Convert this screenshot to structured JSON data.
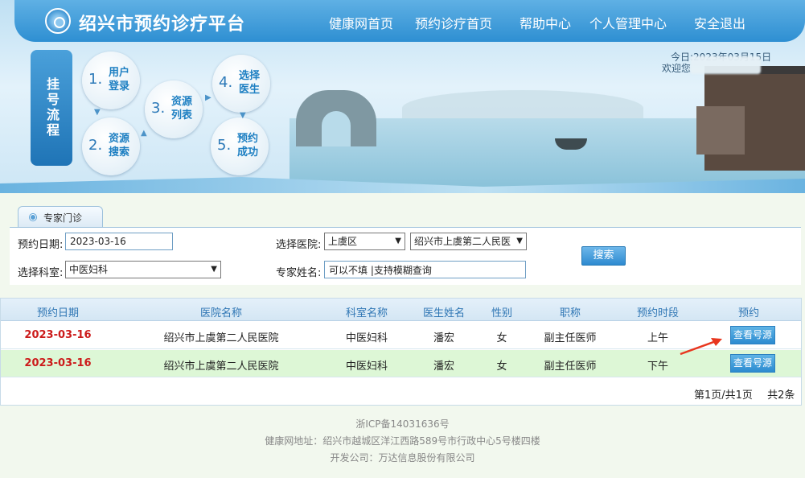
{
  "header": {
    "title": "绍兴市预约诊疗平台",
    "nav": [
      "健康网首页",
      "预约诊疗首页",
      "帮助中心",
      "个人管理中心",
      "安全退出"
    ],
    "date_text": "今日:2023年03月15日",
    "welcome_text": "欢迎您"
  },
  "process": {
    "label": "挂号流程",
    "steps": [
      {
        "num": "1.",
        "text": "用户\n登录"
      },
      {
        "num": "2.",
        "text": "资源\n搜索"
      },
      {
        "num": "3.",
        "text": "资源\n列表"
      },
      {
        "num": "4.",
        "text": "选择\n医生"
      },
      {
        "num": "5.",
        "text": "预约\n成功"
      }
    ]
  },
  "search": {
    "tab_label": "专家门诊",
    "date_label": "预约日期:",
    "date_value": "2023-03-16",
    "hospital_label": "选择医院:",
    "district_value": "上虞区",
    "hospital_value": "绍兴市上虞第二人民医",
    "dept_label": "选择科室:",
    "dept_value": "中医妇科",
    "expert_label": "专家姓名:",
    "expert_placeholder": "可以不填 |支持模糊查询",
    "search_button": "搜索"
  },
  "table": {
    "headers": [
      "预约日期",
      "医院名称",
      "科室名称",
      "医生姓名",
      "性别",
      "职称",
      "预约时段",
      "预约"
    ],
    "rows": [
      {
        "date": "2023-03-16",
        "hospital": "绍兴市上虞第二人民医院",
        "dept": "中医妇科",
        "doctor": "潘宏",
        "gender": "女",
        "title": "副主任医师",
        "period": "上午",
        "action": "查看号源"
      },
      {
        "date": "2023-03-16",
        "hospital": "绍兴市上虞第二人民医院",
        "dept": "中医妇科",
        "doctor": "潘宏",
        "gender": "女",
        "title": "副主任医师",
        "period": "下午",
        "action": "查看号源"
      }
    ],
    "pager_page": "第1页/共1页",
    "pager_total": "共2条"
  },
  "footer": {
    "icp": "浙ICP备14031636号",
    "address": "健康网地址：绍兴市越城区洋江西路589号市行政中心5号楼四楼",
    "developer": "开发公司：万达信息股份有限公司"
  },
  "colors": {
    "primary": "#2e8fd2",
    "date_red": "#cc1b1b",
    "row_alt": "#ddf7d6",
    "arrow_red": "#e8361e"
  }
}
